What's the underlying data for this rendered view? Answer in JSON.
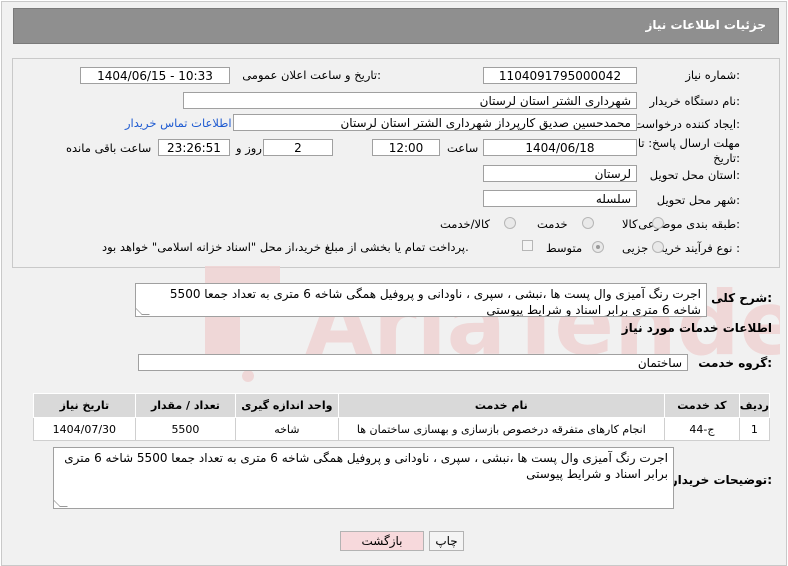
{
  "header": {
    "title": "جزئیات اطلاعات نیاز"
  },
  "fields": {
    "need_number_label": "شماره نیاز:",
    "need_number": "1104091795000042",
    "announce_label": "تاریخ و ساعت اعلان عمومی:",
    "announce_value": "1404/06/15 - 10:33",
    "buyer_org_label": "نام دستگاه خریدار:",
    "buyer_org": "شهرداری الشتر استان لرستان",
    "creator_label": "ایجاد کننده درخواست:",
    "creator": "محمدحسین صدیق کارپرداز شهرداری الشتر استان لرستان",
    "contact_link": "اطلاعات تماس خریدار",
    "deadline_label_1": "مهلت ارسال پاسخ: تا",
    "deadline_label_2": "تاریخ:",
    "deadline_date": "1404/06/18",
    "time_label": "ساعت",
    "deadline_time": "12:00",
    "days_value": "2",
    "days_label": "روز و",
    "remaining_time": "23:26:51",
    "remaining_label": "ساعت باقی مانده",
    "province_label": "استان محل تحویل:",
    "province": "لرستان",
    "city_label": "شهر محل تحویل:",
    "city": "سلسله",
    "category_label": "طبقه بندی موضوعی:",
    "category_options": [
      "کالا",
      "خدمت",
      "کالا/خدمت"
    ],
    "category_selected": "خدمت",
    "process_label": "نوع فرآیند خرید :",
    "process_options": [
      "جزیی",
      "متوسط"
    ],
    "process_selected": "متوسط",
    "payment_note": "پرداخت تمام یا بخشی از مبلغ خرید،از محل \"اسناد خزانه اسلامی\" خواهد بود."
  },
  "summary": {
    "label": "شرح کلی نیاز:",
    "text": "اجرت رنگ آمیزی وال پست ها ،نبشی ، سپری ، ناودانی و پروفیل همگی شاخه 6 متری به تعداد جمعا 5500 شاخه 6 متری برابر اسناد و شرایط پیوستی"
  },
  "services": {
    "section_title": "اطلاعات خدمات مورد نیاز",
    "group_label": "گروه خدمت:",
    "group_value": "ساختمان",
    "columns": [
      "ردیف",
      "کد خدمت",
      "نام خدمت",
      "واحد اندازه گیری",
      "تعداد / مقدار",
      "تاریخ نیاز"
    ],
    "rows": [
      [
        "1",
        "ج-44",
        "انجام کارهای متفرقه درخصوص بازسازی و بهسازی ساختمان ها",
        "شاخه",
        "5500",
        "1404/07/30"
      ]
    ]
  },
  "buyer_notes": {
    "label": "توضیحات خریدار:",
    "text": "اجرت رنگ آمیزی وال پست ها ،نبشی ، سپری ، ناودانی و پروفیل همگی شاخه 6 متری به تعداد جمعا 5500 شاخه 6 متری برابر اسناد و شرایط پیوستی"
  },
  "buttons": {
    "print": "چاپ",
    "back": "بازگشت"
  },
  "colors": {
    "titlebar": "#8f8f8f",
    "link": "#1f5bd1",
    "back_button": "#f7d9dc",
    "watermark": "#e8c7c7"
  }
}
